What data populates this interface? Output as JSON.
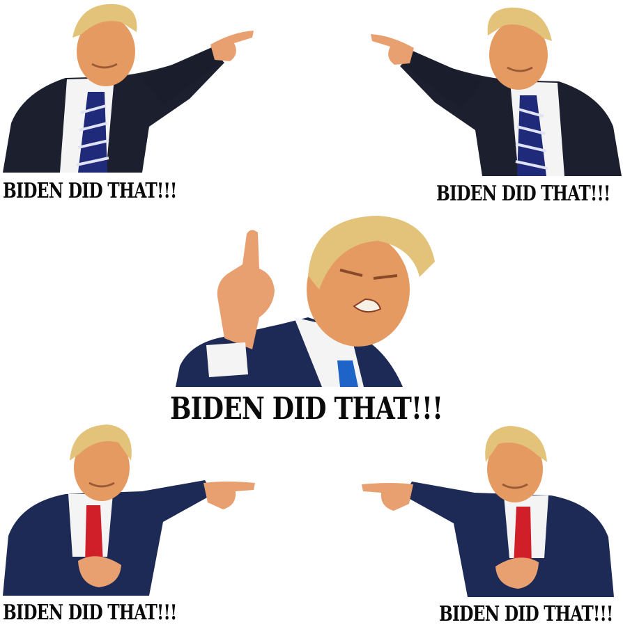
{
  "stickers": [
    {
      "caption": "BIDEN DID THAT!!!",
      "tie_color": "#1f2a7a",
      "pose": "pointing-right"
    },
    {
      "caption": "BIDEN DID THAT!!!",
      "tie_color": "#1f2a7a",
      "pose": "pointing-left"
    },
    {
      "caption": "BIDEN DID THAT!!!",
      "tie_color": "#1e63c8",
      "pose": "finger-up"
    },
    {
      "caption": "BIDEN DID THAT!!!",
      "tie_color": "#d11f2a",
      "pose": "pointing-right"
    },
    {
      "caption": "BIDEN DID THAT!!!",
      "tie_color": "#d11f2a",
      "pose": "pointing-left"
    }
  ],
  "colors": {
    "hair": "#e3c27a",
    "skin": "#e59a62",
    "suit_dark": "#1c1f2e",
    "suit_navy": "#1d2a55",
    "shirt": "#f4f4f4"
  }
}
